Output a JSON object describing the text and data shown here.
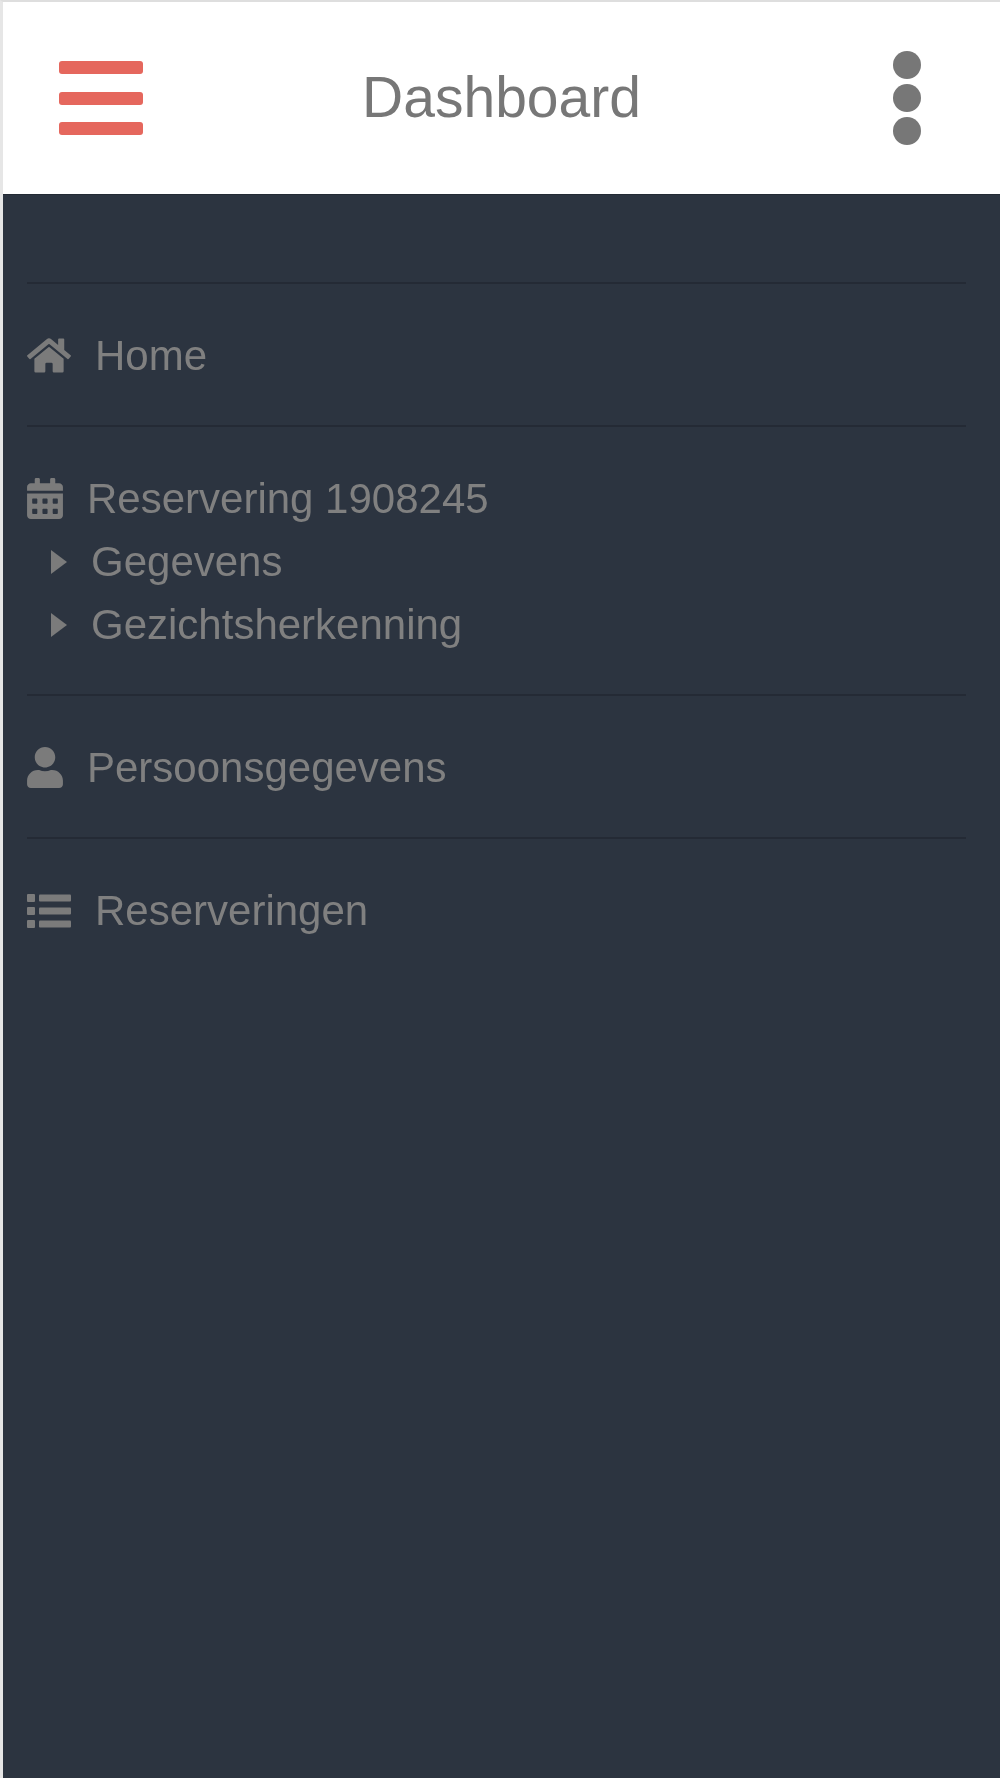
{
  "header": {
    "title": "Dashboard"
  },
  "sidebar": {
    "items": [
      {
        "label": "Home"
      },
      {
        "label": "Reservering 1908245",
        "children": [
          {
            "label": "Gegevens"
          },
          {
            "label": "Gezichtsherkenning"
          }
        ]
      },
      {
        "label": "Persoonsgegevens"
      },
      {
        "label": "Reserveringen"
      }
    ]
  }
}
